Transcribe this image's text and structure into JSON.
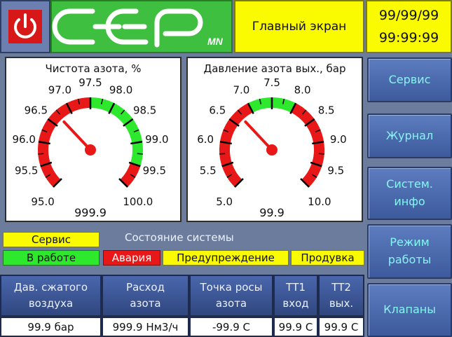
{
  "header": {
    "logo_small": "MN",
    "title": "Главный экран",
    "date": "99/99/99",
    "time": "99:99:99"
  },
  "gauges": [
    {
      "title": "Чистота азота, %",
      "min": 95.0,
      "max": 100.0,
      "labels": [
        "95.0",
        "95.5",
        "96.0",
        "96.5",
        "97.0",
        "97.5",
        "98.0",
        "98.5",
        "99.0",
        "99.5",
        "100.0"
      ],
      "green_from": 97.5,
      "green_to": 99.5,
      "value": 96.7,
      "readout": "999.9"
    },
    {
      "title": "Давление азота вых., бар",
      "min": 5.0,
      "max": 10.0,
      "labels": [
        "5.0",
        "5.5",
        "6.0",
        "6.5",
        "7.0",
        "7.5",
        "8.0",
        "8.5",
        "9.0",
        "9.5",
        "10.0"
      ],
      "green_from": 7.0,
      "green_to": 8.0,
      "value": 6.7,
      "readout": "99.9"
    }
  ],
  "menu": [
    "Сервис",
    "Журнал",
    "Систем.\nинфо",
    "Режим\nработы",
    "Клапаны"
  ],
  "status": {
    "service": "Сервис",
    "running": "В работе",
    "system_state": "Состояние системы",
    "alarm": "Авария",
    "warning": "Предупреждение",
    "purge": "Продувка"
  },
  "table": {
    "headers": [
      "Дав. сжатого\nвоздуха",
      "Расход\nазота",
      "Точка росы\nазота",
      "ТТ1\nвход",
      "ТТ2\nвых."
    ],
    "values": [
      "99.9 бар",
      "999.9 Нм3/ч",
      "-99.9 С",
      "99.9 С",
      "99.9 С"
    ]
  },
  "colors": {
    "red": "#e81818",
    "green": "#2ee82e",
    "yellow": "#fafa00",
    "needle": "#e81818"
  }
}
